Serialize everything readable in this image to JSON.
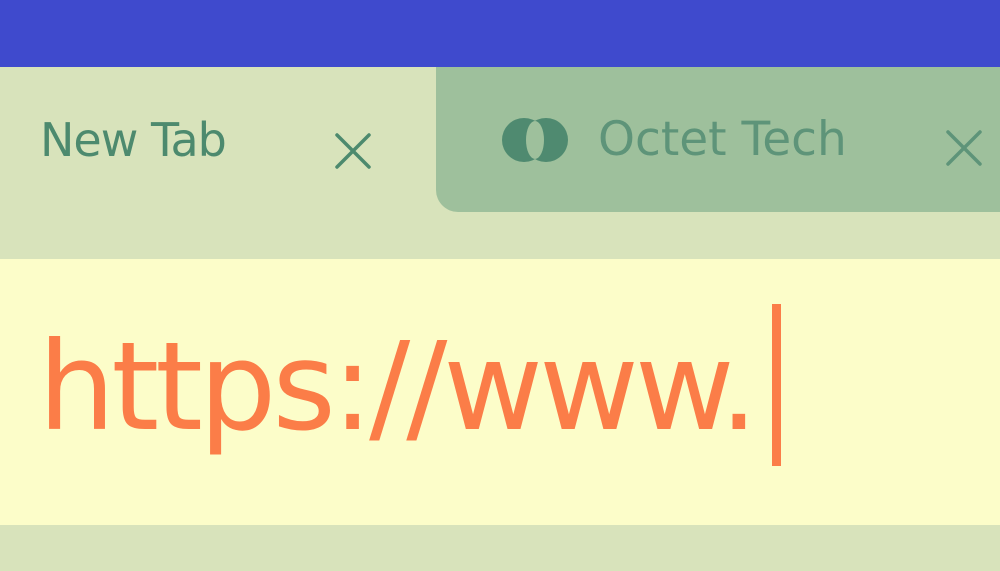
{
  "colors": {
    "title_bar": "#3f4acd",
    "tab_strip": "#d8e3bb",
    "inactive_tab": "#9ec09c",
    "tab_text": "#4d8a6e",
    "address_bar": "#fcfdc9",
    "url_text": "#fb7d48"
  },
  "tabs": [
    {
      "title": "New Tab",
      "active": true,
      "close_icon": "close-icon"
    },
    {
      "title": "Octet Tech",
      "active": false,
      "favicon": "octet-logo-icon",
      "close_icon": "close-icon"
    }
  ],
  "address_bar": {
    "value": "https://www."
  }
}
